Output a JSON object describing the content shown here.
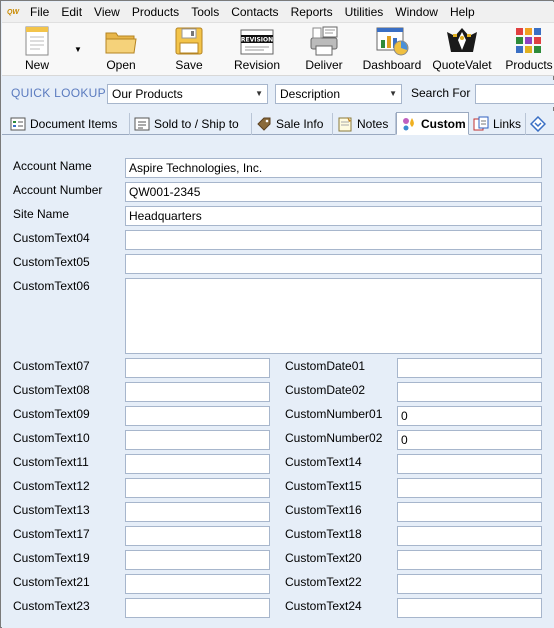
{
  "app": {
    "icon_text": "QW"
  },
  "menu": [
    "File",
    "Edit",
    "View",
    "Products",
    "Tools",
    "Contacts",
    "Reports",
    "Utilities",
    "Window",
    "Help"
  ],
  "toolbar": {
    "new": "New",
    "open": "Open",
    "save": "Save",
    "revision": "Revision",
    "revision_icon_text": "REVISION",
    "deliver": "Deliver",
    "dashboard": "Dashboard",
    "quotevalet": "QuoteValet",
    "products": "Products"
  },
  "lookup": {
    "label": "QUICK LOOKUP",
    "source": "Our Products",
    "field": "Description",
    "search_label": "Search For",
    "search_value": ""
  },
  "tabs": [
    "Document Items",
    "Sold to / Ship to",
    "Sale Info",
    "Notes",
    "Custom",
    "Links"
  ],
  "active_tab": "Custom",
  "form": {
    "account_name": {
      "label": "Account Name",
      "value": "Aspire Technologies, Inc."
    },
    "account_number": {
      "label": "Account Number",
      "value": "QW001-2345"
    },
    "site_name": {
      "label": "Site Name",
      "value": "Headquarters"
    },
    "customtext04": {
      "label": "CustomText04",
      "value": ""
    },
    "customtext05": {
      "label": "CustomText05",
      "value": ""
    },
    "customtext06": {
      "label": "CustomText06",
      "value": ""
    },
    "left": [
      {
        "label": "CustomText07",
        "value": ""
      },
      {
        "label": "CustomText08",
        "value": ""
      },
      {
        "label": "CustomText09",
        "value": ""
      },
      {
        "label": "CustomText10",
        "value": ""
      },
      {
        "label": "CustomText11",
        "value": ""
      },
      {
        "label": "CustomText12",
        "value": ""
      },
      {
        "label": "CustomText13",
        "value": ""
      },
      {
        "label": "CustomText17",
        "value": ""
      },
      {
        "label": "CustomText19",
        "value": ""
      },
      {
        "label": "CustomText21",
        "value": ""
      },
      {
        "label": "CustomText23",
        "value": ""
      }
    ],
    "right": [
      {
        "label": "CustomDate01",
        "value": ""
      },
      {
        "label": "CustomDate02",
        "value": ""
      },
      {
        "label": "CustomNumber01",
        "value": "0"
      },
      {
        "label": "CustomNumber02",
        "value": "0"
      },
      {
        "label": "CustomText14",
        "value": ""
      },
      {
        "label": "CustomText15",
        "value": ""
      },
      {
        "label": "CustomText16",
        "value": ""
      },
      {
        "label": "CustomText18",
        "value": ""
      },
      {
        "label": "CustomText20",
        "value": ""
      },
      {
        "label": "CustomText22",
        "value": ""
      },
      {
        "label": "CustomText24",
        "value": ""
      }
    ]
  }
}
